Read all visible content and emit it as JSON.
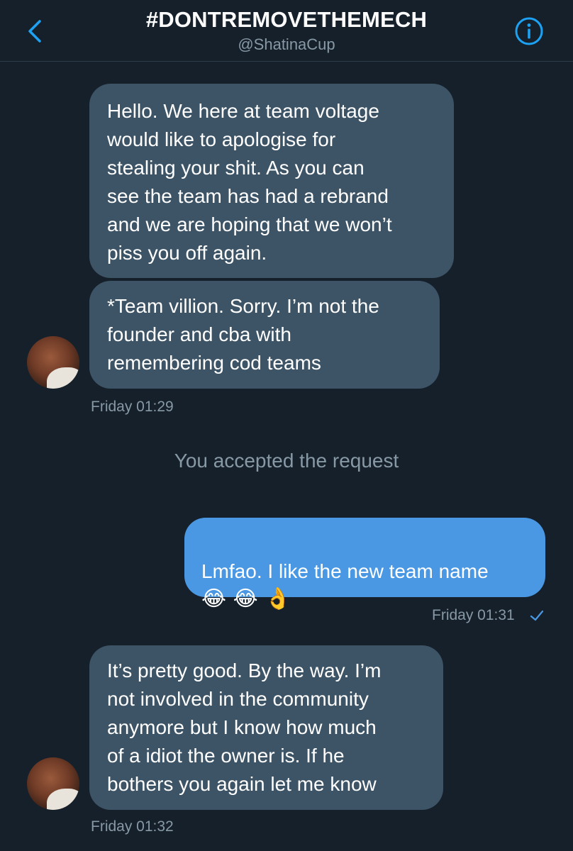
{
  "header": {
    "title": "#DONTREMOVETHEMECH",
    "handle": "@ShatinaCup",
    "back_icon": "chevron-left-icon",
    "info_icon": "info-icon",
    "accent_color": "#1da1f2"
  },
  "messages": [
    {
      "direction": "incoming",
      "text": "Hello. We here at team voltage\nwould like to apologise for\nstealing your shit. As you can\nsee the team has had a rebrand\nand we are hoping that we won’t\npiss you off again."
    },
    {
      "direction": "incoming",
      "text": "*Team villion. Sorry. I’m not the\nfounder and cba with\nremembering cod teams",
      "timestamp": "Friday 01:29"
    },
    {
      "direction": "system",
      "text": "You accepted the request"
    },
    {
      "direction": "outgoing",
      "text": "Lmfao. I like the new team name",
      "emoji": "😂 😂 👌",
      "timestamp": "Friday 01:31",
      "read_icon": "checkmark-icon"
    },
    {
      "direction": "incoming",
      "text": "It’s pretty good. By the way. I’m\nnot involved in the community\nanymore but I know how much\nof a idiot the owner is. If he\nbothers you again let me know",
      "timestamp": "Friday 01:32"
    }
  ],
  "colors": {
    "background": "#15202b",
    "incoming_bubble": "#3d5466",
    "outgoing_bubble": "#4a98e4",
    "secondary_text": "#8899a6"
  }
}
